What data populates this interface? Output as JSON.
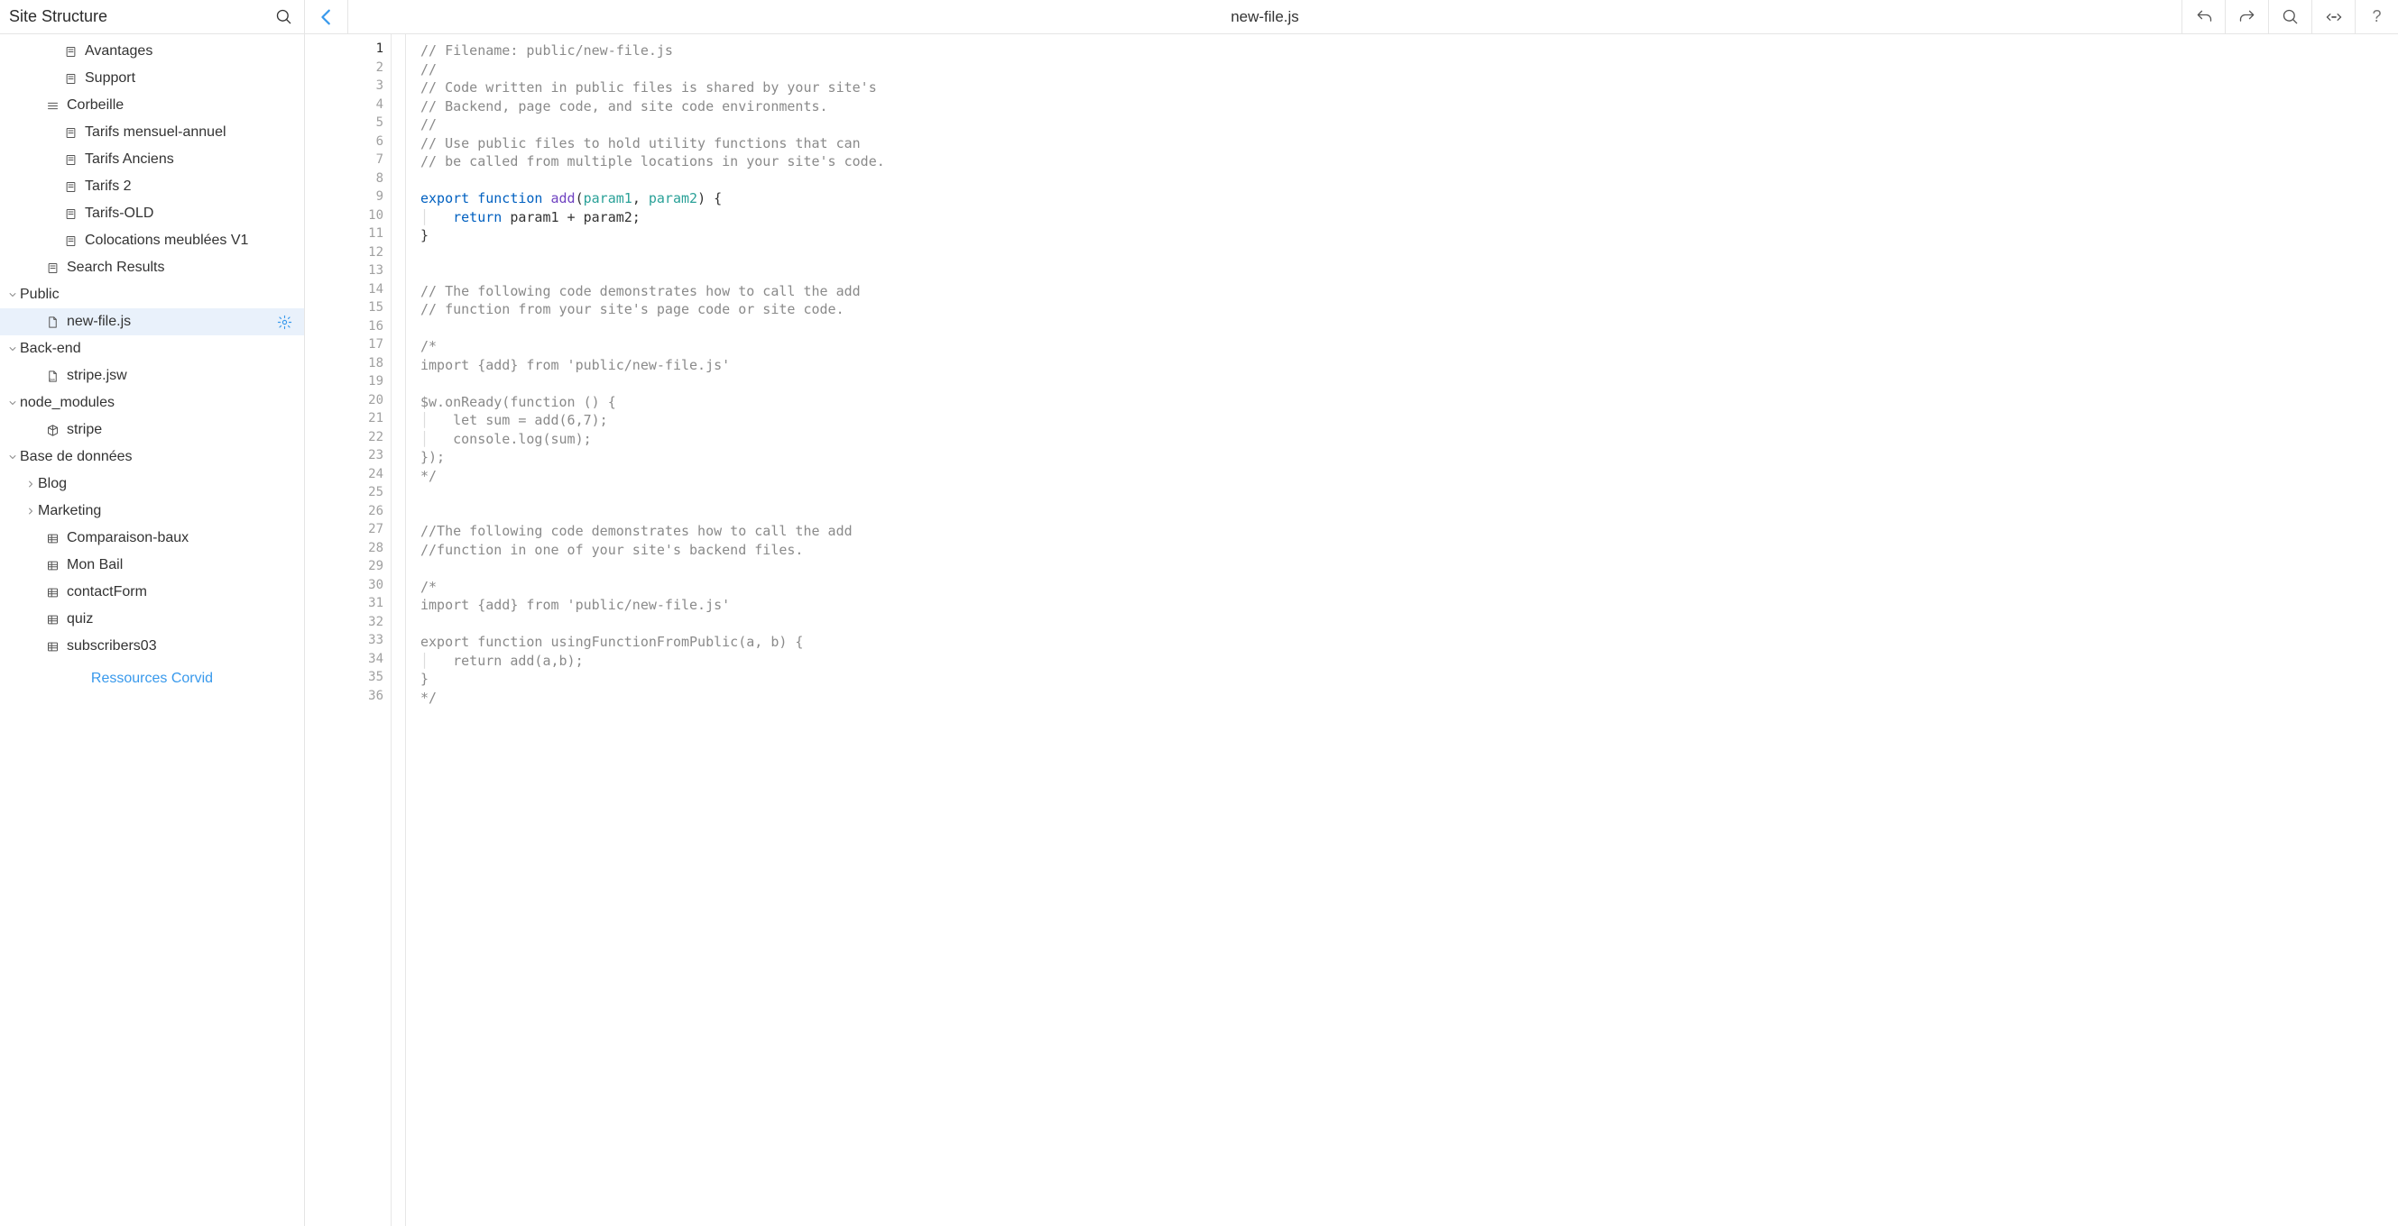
{
  "header": {
    "panel_title": "Site Structure",
    "file_title": "new-file.js"
  },
  "toolbar_icons": {
    "back": "back-arrow",
    "undo": "undo-arrow",
    "redo": "redo-arrow",
    "search": "search-magnifier",
    "expand": "arrows-in-out",
    "help": "?"
  },
  "sidebar": {
    "sections": [
      {
        "label": "Avantages",
        "icon": "page",
        "indent": 3,
        "chev": ""
      },
      {
        "label": "Support",
        "icon": "page",
        "indent": 3,
        "chev": ""
      },
      {
        "label": "Corbeille",
        "icon": "list",
        "indent": 2,
        "chev": ""
      },
      {
        "label": "Tarifs mensuel-annuel",
        "icon": "page",
        "indent": 3,
        "chev": ""
      },
      {
        "label": "Tarifs Anciens",
        "icon": "page",
        "indent": 3,
        "chev": ""
      },
      {
        "label": "Tarifs 2",
        "icon": "page",
        "indent": 3,
        "chev": ""
      },
      {
        "label": "Tarifs-OLD",
        "icon": "page",
        "indent": 3,
        "chev": ""
      },
      {
        "label": "Colocations meublées V1",
        "icon": "page",
        "indent": 3,
        "chev": ""
      },
      {
        "label": "Search Results",
        "icon": "page",
        "indent": 2,
        "chev": ""
      },
      {
        "label": "Public",
        "icon": "",
        "indent": 0,
        "chev": "down"
      },
      {
        "label": "new-file.js",
        "icon": "jsfile",
        "indent": 2,
        "chev": "",
        "selected": true,
        "gear": true
      },
      {
        "label": "Back-end",
        "icon": "",
        "indent": 0,
        "chev": "down"
      },
      {
        "label": "stripe.jsw",
        "icon": "jswfile",
        "indent": 2,
        "chev": ""
      },
      {
        "label": "node_modules",
        "icon": "",
        "indent": 0,
        "chev": "down"
      },
      {
        "label": "stripe",
        "icon": "pkg",
        "indent": 2,
        "chev": ""
      },
      {
        "label": "Base de données",
        "icon": "",
        "indent": 0,
        "chev": "down"
      },
      {
        "label": "Blog",
        "icon": "",
        "indent": 1,
        "chev": "right"
      },
      {
        "label": "Marketing",
        "icon": "",
        "indent": 1,
        "chev": "right"
      },
      {
        "label": "Comparaison-baux",
        "icon": "db",
        "indent": 2,
        "chev": ""
      },
      {
        "label": "Mon Bail",
        "icon": "db",
        "indent": 2,
        "chev": ""
      },
      {
        "label": "contactForm",
        "icon": "db",
        "indent": 2,
        "chev": ""
      },
      {
        "label": "quiz",
        "icon": "db",
        "indent": 2,
        "chev": ""
      },
      {
        "label": "subscribers03",
        "icon": "db",
        "indent": 2,
        "chev": ""
      }
    ],
    "footer_link": "Ressources Corvid"
  },
  "code": {
    "highlight_line": 1,
    "lines": [
      {
        "t": "comment",
        "text": "// Filename: public/new-file.js"
      },
      {
        "t": "comment",
        "text": "//"
      },
      {
        "t": "comment",
        "text": "// Code written in public files is shared by your site's"
      },
      {
        "t": "comment",
        "text": "// Backend, page code, and site code environments."
      },
      {
        "t": "comment",
        "text": "//"
      },
      {
        "t": "comment",
        "text": "// Use public files to hold utility functions that can"
      },
      {
        "t": "comment",
        "text": "// be called from multiple locations in your site's code."
      },
      {
        "t": "blank",
        "text": ""
      },
      {
        "t": "fnsig",
        "kw1": "export",
        "kw2": "function",
        "name": "add",
        "p1": "param1",
        "p2": "param2"
      },
      {
        "t": "return",
        "kw": "return",
        "rest": " param1 + param2;"
      },
      {
        "t": "plain",
        "text": "}"
      },
      {
        "t": "blank",
        "text": ""
      },
      {
        "t": "blank",
        "text": ""
      },
      {
        "t": "comment",
        "text": "// The following code demonstrates how to call the add"
      },
      {
        "t": "comment",
        "text": "// function from your site's page code or site code."
      },
      {
        "t": "blank",
        "text": ""
      },
      {
        "t": "comment",
        "text": "/*"
      },
      {
        "t": "comment",
        "text": "import {add} from 'public/new-file.js'"
      },
      {
        "t": "blank",
        "text": ""
      },
      {
        "t": "comment",
        "text": "$w.onReady(function () {"
      },
      {
        "t": "comment",
        "text": "    let sum = add(6,7);",
        "guide": true
      },
      {
        "t": "comment",
        "text": "    console.log(sum);",
        "guide": true
      },
      {
        "t": "comment",
        "text": "});"
      },
      {
        "t": "comment",
        "text": "*/"
      },
      {
        "t": "blank",
        "text": ""
      },
      {
        "t": "blank",
        "text": ""
      },
      {
        "t": "comment",
        "text": "//The following code demonstrates how to call the add"
      },
      {
        "t": "comment",
        "text": "//function in one of your site's backend files."
      },
      {
        "t": "blank",
        "text": ""
      },
      {
        "t": "comment",
        "text": "/*"
      },
      {
        "t": "comment",
        "text": "import {add} from 'public/new-file.js'"
      },
      {
        "t": "blank",
        "text": ""
      },
      {
        "t": "comment",
        "text": "export function usingFunctionFromPublic(a, b) {"
      },
      {
        "t": "comment",
        "text": "    return add(a,b);",
        "guide": true
      },
      {
        "t": "comment",
        "text": "}"
      },
      {
        "t": "comment",
        "text": "*/"
      }
    ]
  }
}
